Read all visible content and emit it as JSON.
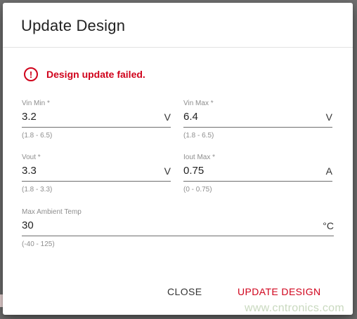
{
  "dialog": {
    "title": "Update Design",
    "error_message": "Design update failed.",
    "fields": {
      "vin_min": {
        "label": "Vin Min *",
        "value": "3.2",
        "unit": "V",
        "hint": "(1.8 - 6.5)"
      },
      "vin_max": {
        "label": "Vin Max *",
        "value": "6.4",
        "unit": "V",
        "hint": "(1.8 - 6.5)"
      },
      "vout": {
        "label": "Vout *",
        "value": "3.3",
        "unit": "V",
        "hint": "(1.8 - 3.3)"
      },
      "iout_max": {
        "label": "Iout Max *",
        "value": "0.75",
        "unit": "A",
        "hint": "(0 - 0.75)"
      },
      "max_ambient_temp": {
        "label": "Max Ambient Temp",
        "value": "30",
        "unit": "°C",
        "hint": "(-40 - 125)"
      }
    },
    "buttons": {
      "close_label": "CLOSE",
      "update_label": "UPDATE DESIGN"
    }
  },
  "watermark": "www.cntronics.com",
  "colors": {
    "error": "#d0021b",
    "update_button": "#d0021b"
  }
}
